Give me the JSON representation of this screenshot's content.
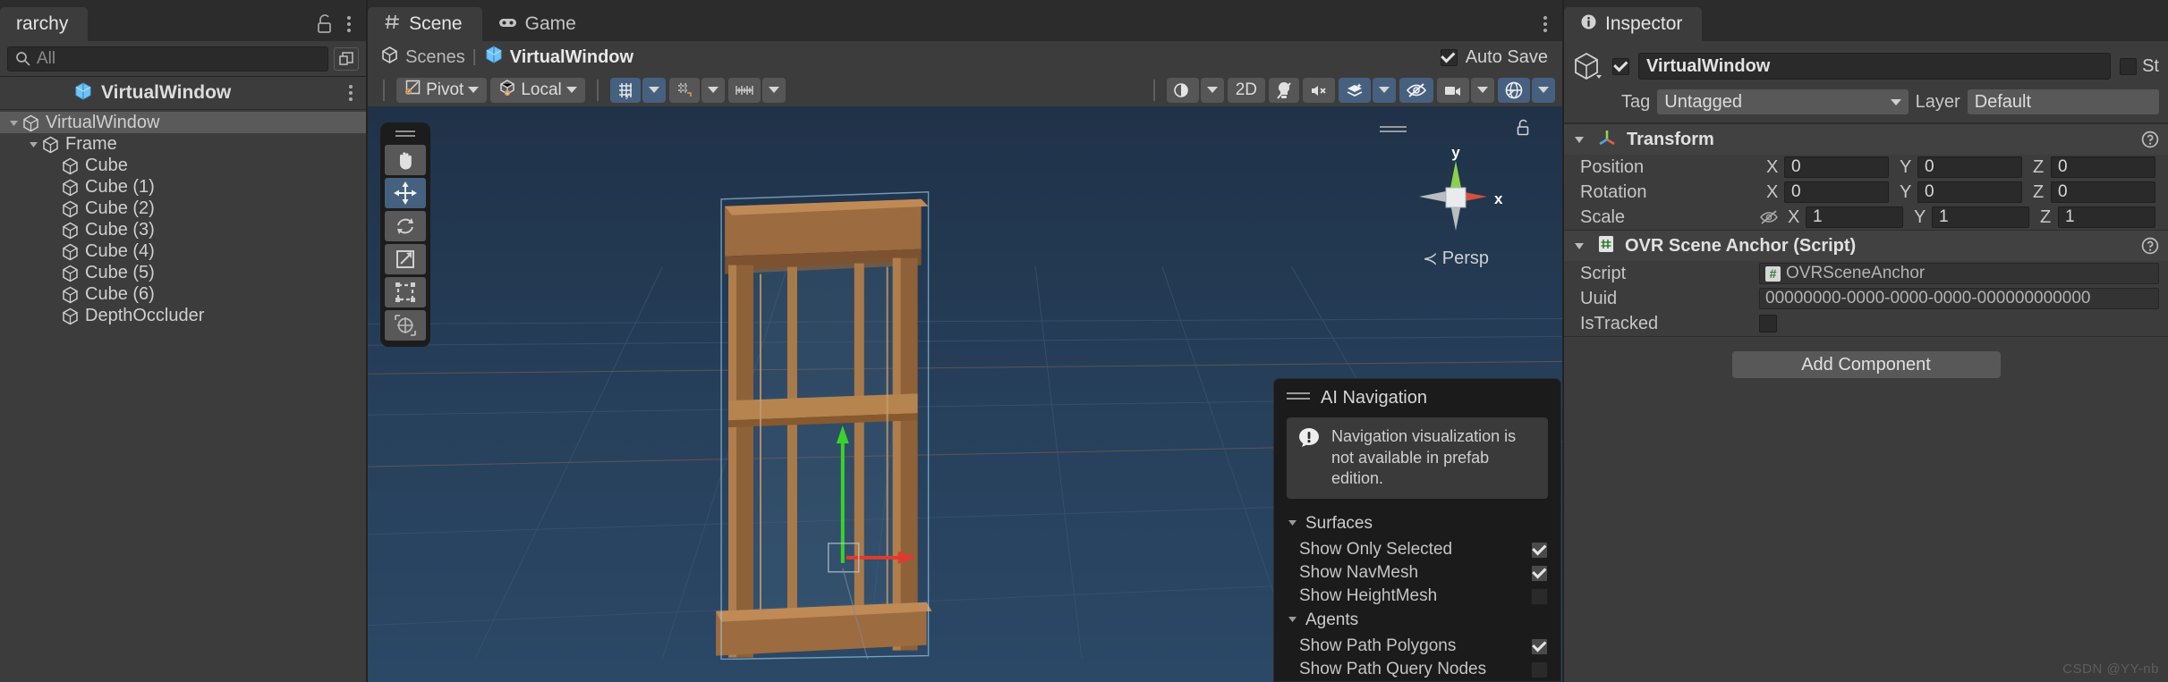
{
  "hierarchy": {
    "tab_label": "rarchy",
    "lock_icon": "lock-open-icon",
    "menu_icon": "kebab-menu-icon",
    "search": {
      "placeholder": "All",
      "icon": "search-icon",
      "open_icon": "open-in-new-icon"
    },
    "prefab_title": "VirtualWindow",
    "prefab_icon": "prefab-cube-icon",
    "items": [
      {
        "label": "VirtualWindow",
        "depth": 0,
        "expanded": true,
        "selected": true,
        "icon": "gameobject-cube-icon"
      },
      {
        "label": "Frame",
        "depth": 1,
        "expanded": true,
        "selected": false,
        "icon": "gameobject-cube-icon"
      },
      {
        "label": "Cube",
        "depth": 2,
        "expanded": null,
        "selected": false,
        "icon": "gameobject-cube-icon"
      },
      {
        "label": "Cube (1)",
        "depth": 2,
        "expanded": null,
        "selected": false,
        "icon": "gameobject-cube-icon"
      },
      {
        "label": "Cube (2)",
        "depth": 2,
        "expanded": null,
        "selected": false,
        "icon": "gameobject-cube-icon"
      },
      {
        "label": "Cube (3)",
        "depth": 2,
        "expanded": null,
        "selected": false,
        "icon": "gameobject-cube-icon"
      },
      {
        "label": "Cube (4)",
        "depth": 2,
        "expanded": null,
        "selected": false,
        "icon": "gameobject-cube-icon"
      },
      {
        "label": "Cube (5)",
        "depth": 2,
        "expanded": null,
        "selected": false,
        "icon": "gameobject-cube-icon"
      },
      {
        "label": "Cube (6)",
        "depth": 2,
        "expanded": null,
        "selected": false,
        "icon": "gameobject-cube-icon"
      },
      {
        "label": "DepthOccluder",
        "depth": 2,
        "expanded": null,
        "selected": false,
        "icon": "gameobject-cube-icon"
      }
    ]
  },
  "scene": {
    "tabs": [
      {
        "label": "Scene",
        "icon": "scene-hash-icon",
        "active": true
      },
      {
        "label": "Game",
        "icon": "gamepad-icon",
        "active": false
      }
    ],
    "menu_icon": "kebab-menu-icon",
    "breadcrumb": {
      "scenes_label": "Scenes",
      "scenes_icon": "unity-logo-icon",
      "separator": "|",
      "current_label": "VirtualWindow",
      "current_icon": "prefab-cube-icon"
    },
    "auto_save": {
      "label": "Auto Save",
      "checked": true
    },
    "toolbar": {
      "pivot": {
        "label": "Pivot",
        "icon": "pivot-icon"
      },
      "local": {
        "label": "Local",
        "icon": "local-handle-icon"
      },
      "grid_snap": {
        "icon": "grid-snap-icon",
        "active": true
      },
      "grid_snap_dropdown": {
        "icon": "chevron-down-icon",
        "active": true
      },
      "grid_visibility": {
        "icon": "grid-visibility-icon",
        "active": false
      },
      "grid_visibility_dropdown": {
        "icon": "chevron-down-icon",
        "active": false
      },
      "snap_increment": {
        "icon": "snap-increment-icon",
        "active": false
      },
      "snap_increment_dropdown": {
        "icon": "chevron-down-icon",
        "active": false
      },
      "shading_mode": {
        "icon": "shaded-sphere-icon",
        "active": false
      },
      "shading_dropdown": {
        "icon": "chevron-down-icon",
        "active": false
      },
      "mode_2d": {
        "label": "2D",
        "active": false
      },
      "lighting": {
        "icon": "lighting-off-icon",
        "active": false
      },
      "audio": {
        "icon": "audio-mute-icon",
        "active": false
      },
      "fx": {
        "icon": "effects-icon",
        "active": true
      },
      "fx_dropdown": {
        "icon": "chevron-down-icon",
        "active": true
      },
      "scene_vis": {
        "icon": "eye-off-icon",
        "active": true
      },
      "camera": {
        "icon": "camera-icon",
        "active": false
      },
      "camera_dropdown": {
        "icon": "chevron-down-icon",
        "active": false
      },
      "gizmos": {
        "icon": "gizmos-globe-icon",
        "active": true
      },
      "gizmos_dropdown": {
        "icon": "chevron-down-icon",
        "active": true
      }
    },
    "tool_palette": [
      {
        "name": "hand-tool",
        "icon": "hand-icon",
        "active": false
      },
      {
        "name": "move-tool",
        "icon": "move-arrows-icon",
        "active": true
      },
      {
        "name": "rotate-tool",
        "icon": "rotate-icon",
        "active": false
      },
      {
        "name": "scale-tool",
        "icon": "scale-icon",
        "active": false
      },
      {
        "name": "rect-tool",
        "icon": "rect-transform-icon",
        "active": false
      },
      {
        "name": "transform-tool",
        "icon": "transform-combined-icon",
        "active": false
      }
    ],
    "gizmo": {
      "axis_y": "y",
      "axis_x": "x",
      "projection": "Persp",
      "back_arrow": "≺",
      "lock_icon": "lock-open-icon"
    },
    "ai_navigation": {
      "title": "AI Navigation",
      "warning": "Navigation visualization is not available in prefab edition.",
      "warning_icon": "warning-bubble-icon",
      "sections": [
        {
          "label": "Surfaces",
          "expanded": true,
          "rows": [
            {
              "label": "Show Only Selected",
              "checked": true
            },
            {
              "label": "Show NavMesh",
              "checked": true
            },
            {
              "label": "Show HeightMesh",
              "checked": false
            }
          ]
        },
        {
          "label": "Agents",
          "expanded": true,
          "rows": [
            {
              "label": "Show Path Polygons",
              "checked": true
            },
            {
              "label": "Show Path Query Nodes",
              "checked": false
            }
          ]
        }
      ]
    }
  },
  "inspector": {
    "tab_label": "Inspector",
    "tab_icon": "info-circle-icon",
    "object": {
      "icon": "gameobject-cube-icon",
      "enabled": true,
      "name": "VirtualWindow",
      "static_label": "St",
      "static_checked": false,
      "tag_label": "Tag",
      "tag_value": "Untagged",
      "layer_label": "Layer",
      "layer_value": "Default"
    },
    "components": [
      {
        "title": "Transform",
        "icon": "transform-axis-icon",
        "expanded": true,
        "help_icon": "help-circle-icon",
        "rows": [
          {
            "label": "Position",
            "type": "vec3",
            "has_eye": false,
            "x": "0",
            "y": "0",
            "z": "0"
          },
          {
            "label": "Rotation",
            "type": "vec3",
            "has_eye": false,
            "x": "0",
            "y": "0",
            "z": "0"
          },
          {
            "label": "Scale",
            "type": "vec3",
            "has_eye": true,
            "eye_icon": "eye-off-icon",
            "x": "1",
            "y": "1",
            "z": "1"
          }
        ]
      },
      {
        "title": "OVR Scene Anchor (Script)",
        "icon": "csharp-script-icon",
        "expanded": true,
        "help_icon": "help-circle-icon",
        "rows": [
          {
            "label": "Script",
            "type": "object",
            "value": "OVRSceneAnchor",
            "chip": "#"
          },
          {
            "label": "Uuid",
            "type": "text",
            "value": "00000000-0000-0000-0000-000000000000"
          },
          {
            "label": "IsTracked",
            "type": "checkbox",
            "checked": false
          }
        ]
      }
    ],
    "add_component_label": "Add Component",
    "axis_labels": {
      "x": "X",
      "y": "Y",
      "z": "Z"
    }
  },
  "watermark": "CSDN @YY-nb"
}
